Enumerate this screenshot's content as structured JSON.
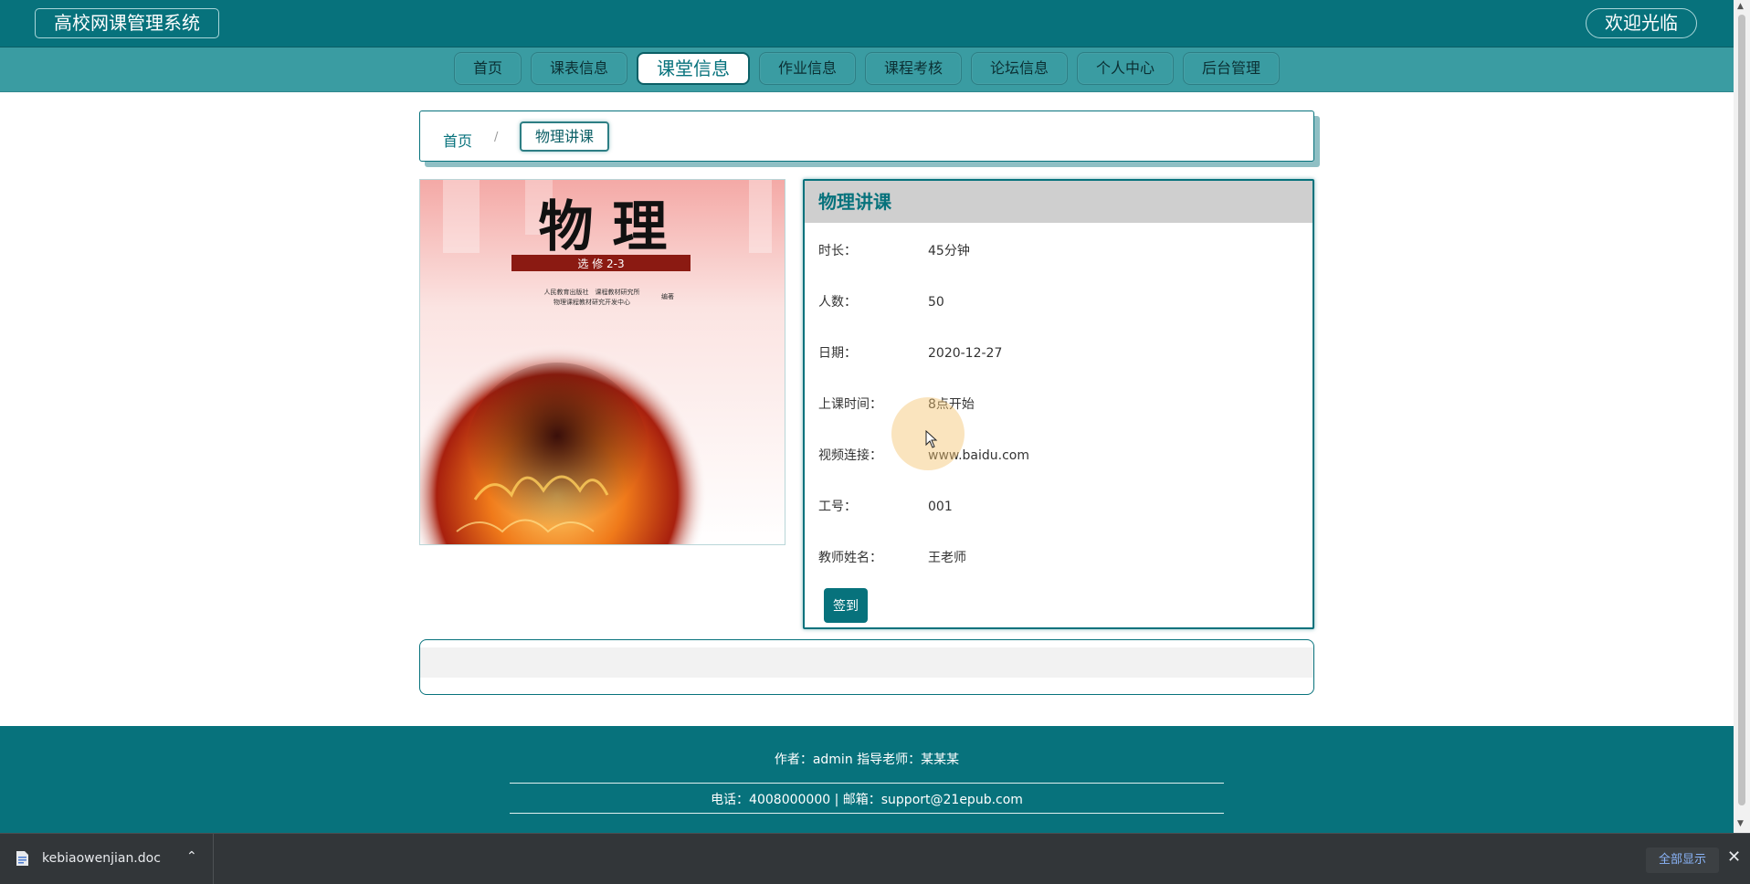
{
  "header": {
    "brand": "高校网课管理系统",
    "welcome": "欢迎光临"
  },
  "nav": {
    "items": [
      {
        "label": "首页"
      },
      {
        "label": "课表信息"
      },
      {
        "label": "课堂信息",
        "active": true
      },
      {
        "label": "作业信息"
      },
      {
        "label": "课程考核"
      },
      {
        "label": "论坛信息"
      },
      {
        "label": "个人中心"
      },
      {
        "label": "后台管理"
      }
    ]
  },
  "breadcrumb": {
    "home": "首页",
    "separator": "/",
    "current": "物理讲课"
  },
  "cover": {
    "title": "物 理",
    "subtitle": "选 修 2-3",
    "publisher_line1": "人民教育出版社　课程教材研究所",
    "publisher_line2": "物理课程教材研究开发中心",
    "publisher_suffix": "编著"
  },
  "detail": {
    "title": "物理讲课",
    "fields": [
      {
        "label": "时长：",
        "value": "45分钟"
      },
      {
        "label": "人数：",
        "value": "50"
      },
      {
        "label": "日期：",
        "value": "2020-12-27"
      },
      {
        "label": "上课时间：",
        "value": "8点开始"
      },
      {
        "label": "视频连接：",
        "value": "www.baidu.com"
      },
      {
        "label": "工号：",
        "value": "001"
      },
      {
        "label": "教师姓名：",
        "value": "王老师"
      }
    ],
    "signin_label": "签到"
  },
  "footer": {
    "line1": "作者：admin 指导老师：某某某",
    "line2": "电话：4008000000 | 邮箱：support@21epub.com"
  },
  "download_bar": {
    "file_name": "kebiaowenjian.doc",
    "show_all": "全部显示"
  },
  "colors": {
    "primary": "#07727c",
    "nav_bg": "#3a9ca2",
    "panel_title_bg": "#cfcfcf"
  }
}
